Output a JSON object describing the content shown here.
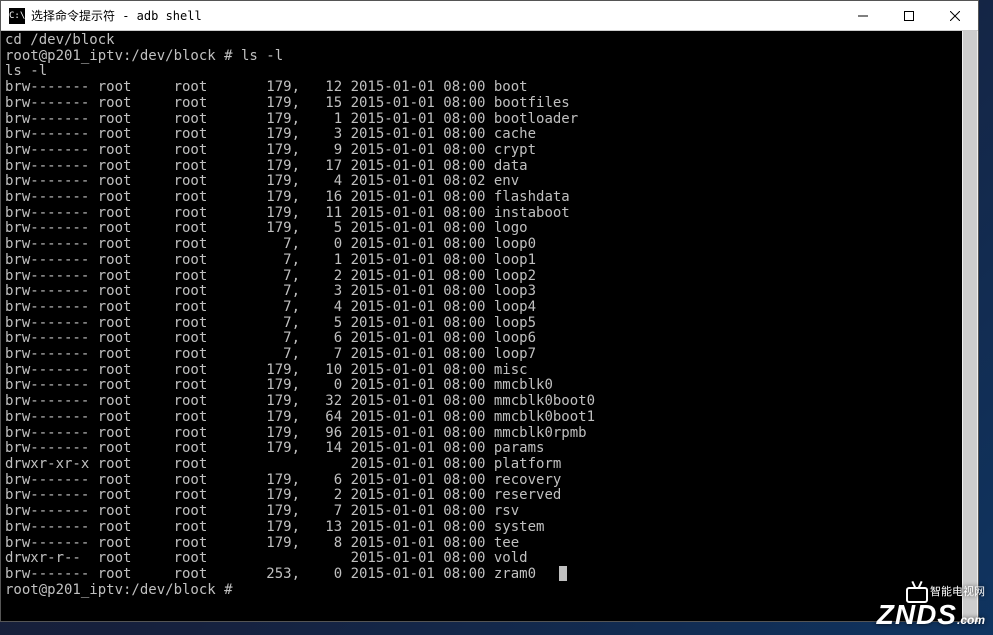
{
  "titlebar": {
    "icon_text": "C:\\",
    "title": "选择命令提示符 - adb  shell"
  },
  "terminal": {
    "cmd1": "cd /dev/block",
    "prompt1": "root@p201_iptv:/dev/block # ls -l",
    "echo1": "ls -l",
    "listing": [
      {
        "perm": "brw-------",
        "owner": "root",
        "group": "root",
        "maj": "179,",
        "min": "12",
        "date": "2015-01-01 08:00",
        "name": "boot"
      },
      {
        "perm": "brw-------",
        "owner": "root",
        "group": "root",
        "maj": "179,",
        "min": "15",
        "date": "2015-01-01 08:00",
        "name": "bootfiles"
      },
      {
        "perm": "brw-------",
        "owner": "root",
        "group": "root",
        "maj": "179,",
        "min": "1",
        "date": "2015-01-01 08:00",
        "name": "bootloader"
      },
      {
        "perm": "brw-------",
        "owner": "root",
        "group": "root",
        "maj": "179,",
        "min": "3",
        "date": "2015-01-01 08:00",
        "name": "cache"
      },
      {
        "perm": "brw-------",
        "owner": "root",
        "group": "root",
        "maj": "179,",
        "min": "9",
        "date": "2015-01-01 08:00",
        "name": "crypt"
      },
      {
        "perm": "brw-------",
        "owner": "root",
        "group": "root",
        "maj": "179,",
        "min": "17",
        "date": "2015-01-01 08:00",
        "name": "data"
      },
      {
        "perm": "brw-------",
        "owner": "root",
        "group": "root",
        "maj": "179,",
        "min": "4",
        "date": "2015-01-01 08:02",
        "name": "env"
      },
      {
        "perm": "brw-------",
        "owner": "root",
        "group": "root",
        "maj": "179,",
        "min": "16",
        "date": "2015-01-01 08:00",
        "name": "flashdata"
      },
      {
        "perm": "brw-------",
        "owner": "root",
        "group": "root",
        "maj": "179,",
        "min": "11",
        "date": "2015-01-01 08:00",
        "name": "instaboot"
      },
      {
        "perm": "brw-------",
        "owner": "root",
        "group": "root",
        "maj": "179,",
        "min": "5",
        "date": "2015-01-01 08:00",
        "name": "logo"
      },
      {
        "perm": "brw-------",
        "owner": "root",
        "group": "root",
        "maj": "7,",
        "min": "0",
        "date": "2015-01-01 08:00",
        "name": "loop0"
      },
      {
        "perm": "brw-------",
        "owner": "root",
        "group": "root",
        "maj": "7,",
        "min": "1",
        "date": "2015-01-01 08:00",
        "name": "loop1"
      },
      {
        "perm": "brw-------",
        "owner": "root",
        "group": "root",
        "maj": "7,",
        "min": "2",
        "date": "2015-01-01 08:00",
        "name": "loop2"
      },
      {
        "perm": "brw-------",
        "owner": "root",
        "group": "root",
        "maj": "7,",
        "min": "3",
        "date": "2015-01-01 08:00",
        "name": "loop3"
      },
      {
        "perm": "brw-------",
        "owner": "root",
        "group": "root",
        "maj": "7,",
        "min": "4",
        "date": "2015-01-01 08:00",
        "name": "loop4"
      },
      {
        "perm": "brw-------",
        "owner": "root",
        "group": "root",
        "maj": "7,",
        "min": "5",
        "date": "2015-01-01 08:00",
        "name": "loop5"
      },
      {
        "perm": "brw-------",
        "owner": "root",
        "group": "root",
        "maj": "7,",
        "min": "6",
        "date": "2015-01-01 08:00",
        "name": "loop6"
      },
      {
        "perm": "brw-------",
        "owner": "root",
        "group": "root",
        "maj": "7,",
        "min": "7",
        "date": "2015-01-01 08:00",
        "name": "loop7"
      },
      {
        "perm": "brw-------",
        "owner": "root",
        "group": "root",
        "maj": "179,",
        "min": "10",
        "date": "2015-01-01 08:00",
        "name": "misc"
      },
      {
        "perm": "brw-------",
        "owner": "root",
        "group": "root",
        "maj": "179,",
        "min": "0",
        "date": "2015-01-01 08:00",
        "name": "mmcblk0"
      },
      {
        "perm": "brw-------",
        "owner": "root",
        "group": "root",
        "maj": "179,",
        "min": "32",
        "date": "2015-01-01 08:00",
        "name": "mmcblk0boot0"
      },
      {
        "perm": "brw-------",
        "owner": "root",
        "group": "root",
        "maj": "179,",
        "min": "64",
        "date": "2015-01-01 08:00",
        "name": "mmcblk0boot1"
      },
      {
        "perm": "brw-------",
        "owner": "root",
        "group": "root",
        "maj": "179,",
        "min": "96",
        "date": "2015-01-01 08:00",
        "name": "mmcblk0rpmb"
      },
      {
        "perm": "brw-------",
        "owner": "root",
        "group": "root",
        "maj": "179,",
        "min": "14",
        "date": "2015-01-01 08:00",
        "name": "params"
      },
      {
        "perm": "drwxr-xr-x",
        "owner": "root",
        "group": "root",
        "maj": "",
        "min": "",
        "date": "2015-01-01 08:00",
        "name": "platform"
      },
      {
        "perm": "brw-------",
        "owner": "root",
        "group": "root",
        "maj": "179,",
        "min": "6",
        "date": "2015-01-01 08:00",
        "name": "recovery"
      },
      {
        "perm": "brw-------",
        "owner": "root",
        "group": "root",
        "maj": "179,",
        "min": "2",
        "date": "2015-01-01 08:00",
        "name": "reserved"
      },
      {
        "perm": "brw-------",
        "owner": "root",
        "group": "root",
        "maj": "179,",
        "min": "7",
        "date": "2015-01-01 08:00",
        "name": "rsv"
      },
      {
        "perm": "brw-------",
        "owner": "root",
        "group": "root",
        "maj": "179,",
        "min": "13",
        "date": "2015-01-01 08:00",
        "name": "system"
      },
      {
        "perm": "brw-------",
        "owner": "root",
        "group": "root",
        "maj": "179,",
        "min": "8",
        "date": "2015-01-01 08:00",
        "name": "tee"
      },
      {
        "perm": "drwxr-r--",
        "owner": "root",
        "group": "root",
        "maj": "",
        "min": "",
        "date": "2015-01-01 08:00",
        "name": "vold"
      },
      {
        "perm": "brw-------",
        "owner": "root",
        "group": "root",
        "maj": "253,",
        "min": "0",
        "date": "2015-01-01 08:00",
        "name": "zram0"
      }
    ],
    "prompt2": "root@p201_iptv:/dev/block # "
  },
  "watermark": {
    "top": "智能电视网",
    "main": "ZNDS",
    "suffix": ".com"
  }
}
